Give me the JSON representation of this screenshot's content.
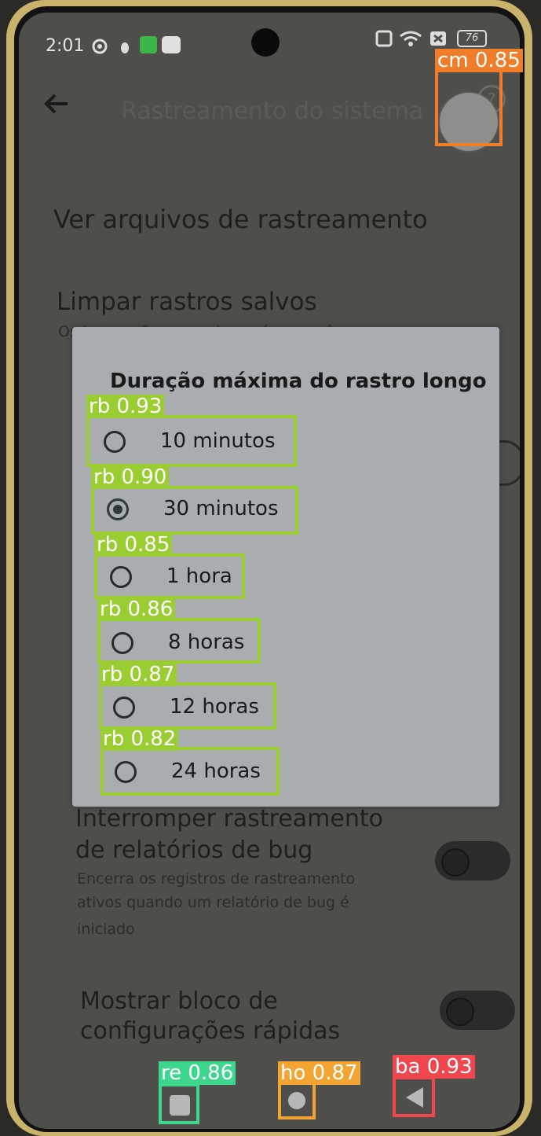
{
  "status_bar": {
    "time": "2:01",
    "battery": "76",
    "icons": [
      "settings-gear-icon",
      "android-bug-icon",
      "green-app-icon",
      "white-app-icon",
      "nfc-icon",
      "wifi-icon",
      "sim-off-icon",
      "battery-icon"
    ]
  },
  "app_bar": {
    "title": "Rastreamento do sistema",
    "back_icon": "back-arrow-icon",
    "help_icon": "help-icon",
    "help_glyph": "?"
  },
  "settings": {
    "view_files": "Ver arquivos de rastreamento",
    "clear_title": "Limpar rastros salvos",
    "clear_sub": "Os traces são apagados após um mês",
    "stop_title_line1": "Interromper rastreamento",
    "stop_title_line2": "de relatórios de bug",
    "stop_sub_line1": "Encerra os registros de rastreamento",
    "stop_sub_line2": "ativos quando um relatório de bug é",
    "stop_sub_line3": "iniciado",
    "quick_title_line1": "Mostrar bloco de",
    "quick_title_line2": "configurações rápidas"
  },
  "dialog": {
    "title": "Duração máxima do rastro longo",
    "selected": "30 minutos",
    "options": [
      "10 minutos",
      "30 minutos",
      "1 hora",
      "8 horas",
      "12 horas",
      "24 horas"
    ]
  },
  "detections": {
    "cm": "cm 0.85",
    "rb": [
      "rb 0.93",
      "rb 0.90",
      "rb 0.85",
      "rb 0.86",
      "rb 0.87",
      "rb 0.82"
    ],
    "re": "re 0.86",
    "ho": "ho 0.87",
    "ba": "ba 0.93",
    "colors": {
      "cm": "#f07d2a",
      "rb": "#9acd32",
      "re": "#3dd68c",
      "ho": "#f2a533",
      "ba": "#f0474f"
    }
  },
  "nav_bar": {
    "recents_icon": "recents-square-icon",
    "home_icon": "home-circle-icon",
    "back_icon": "back-triangle-icon"
  }
}
